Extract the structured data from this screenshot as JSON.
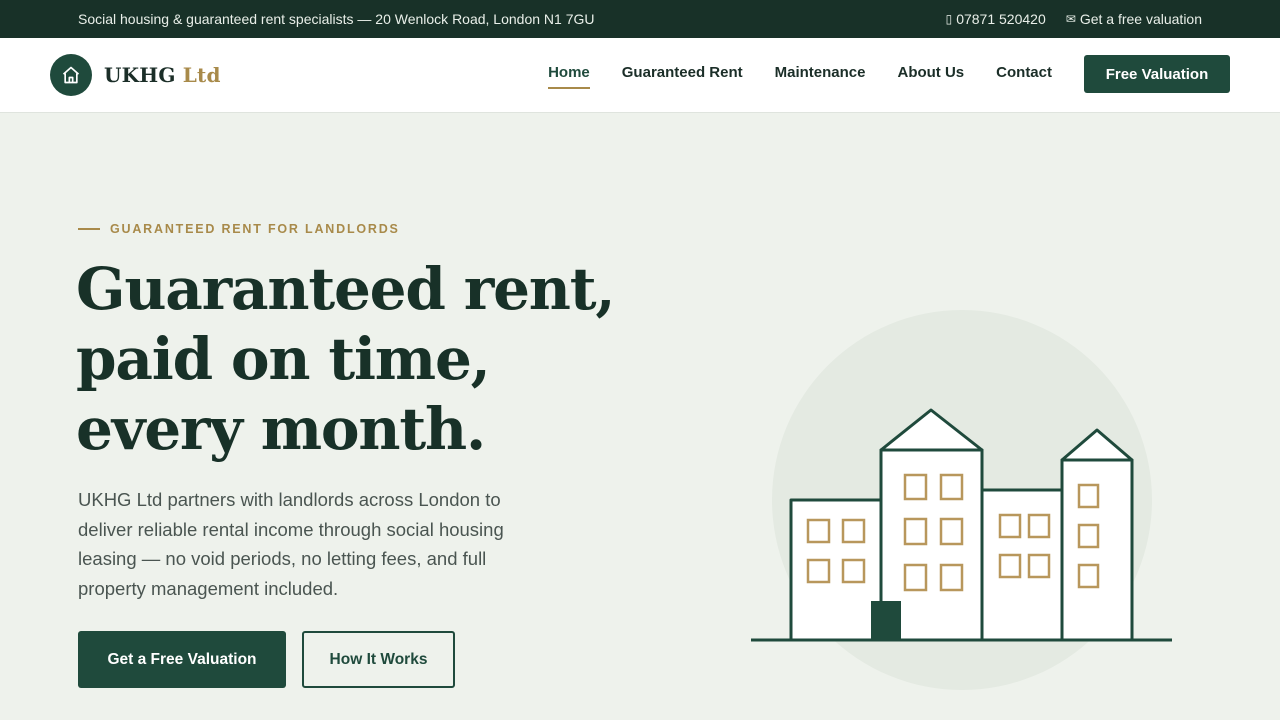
{
  "topbar": {
    "address": "Social housing & guaranteed rent specialists — 20 Wenlock Road, London N1 7GU",
    "phone": "07871 520420",
    "email_link": "Get a free valuation",
    "phone_icon": "phone-icon",
    "email_icon": "envelope-icon"
  },
  "brand": {
    "name": "UKHG",
    "suffix": "Ltd",
    "icon": "house-icon"
  },
  "nav": {
    "items": [
      {
        "label": "Home",
        "active": true
      },
      {
        "label": "Guaranteed Rent",
        "active": false
      },
      {
        "label": "Maintenance",
        "active": false
      },
      {
        "label": "About Us",
        "active": false
      },
      {
        "label": "Contact",
        "active": false
      }
    ],
    "cta": "Free Valuation"
  },
  "hero": {
    "eyebrow": "GUARANTEED RENT FOR LANDLORDS",
    "headline": "Guaranteed rent, paid on time, every month.",
    "lead": "UKHG Ltd partners with landlords across London to deliver reliable rental income through social housing leasing — no void periods, no letting fees, and full property management included.",
    "primary_button": "Get a Free Valuation",
    "secondary_button": "How It Works",
    "illustration": "buildings-illustration"
  },
  "colors": {
    "brand_dark": "#183128",
    "brand_green": "#1f4a3c",
    "accent_gold": "#a88a4a",
    "hero_bg": "#eef2ec"
  }
}
